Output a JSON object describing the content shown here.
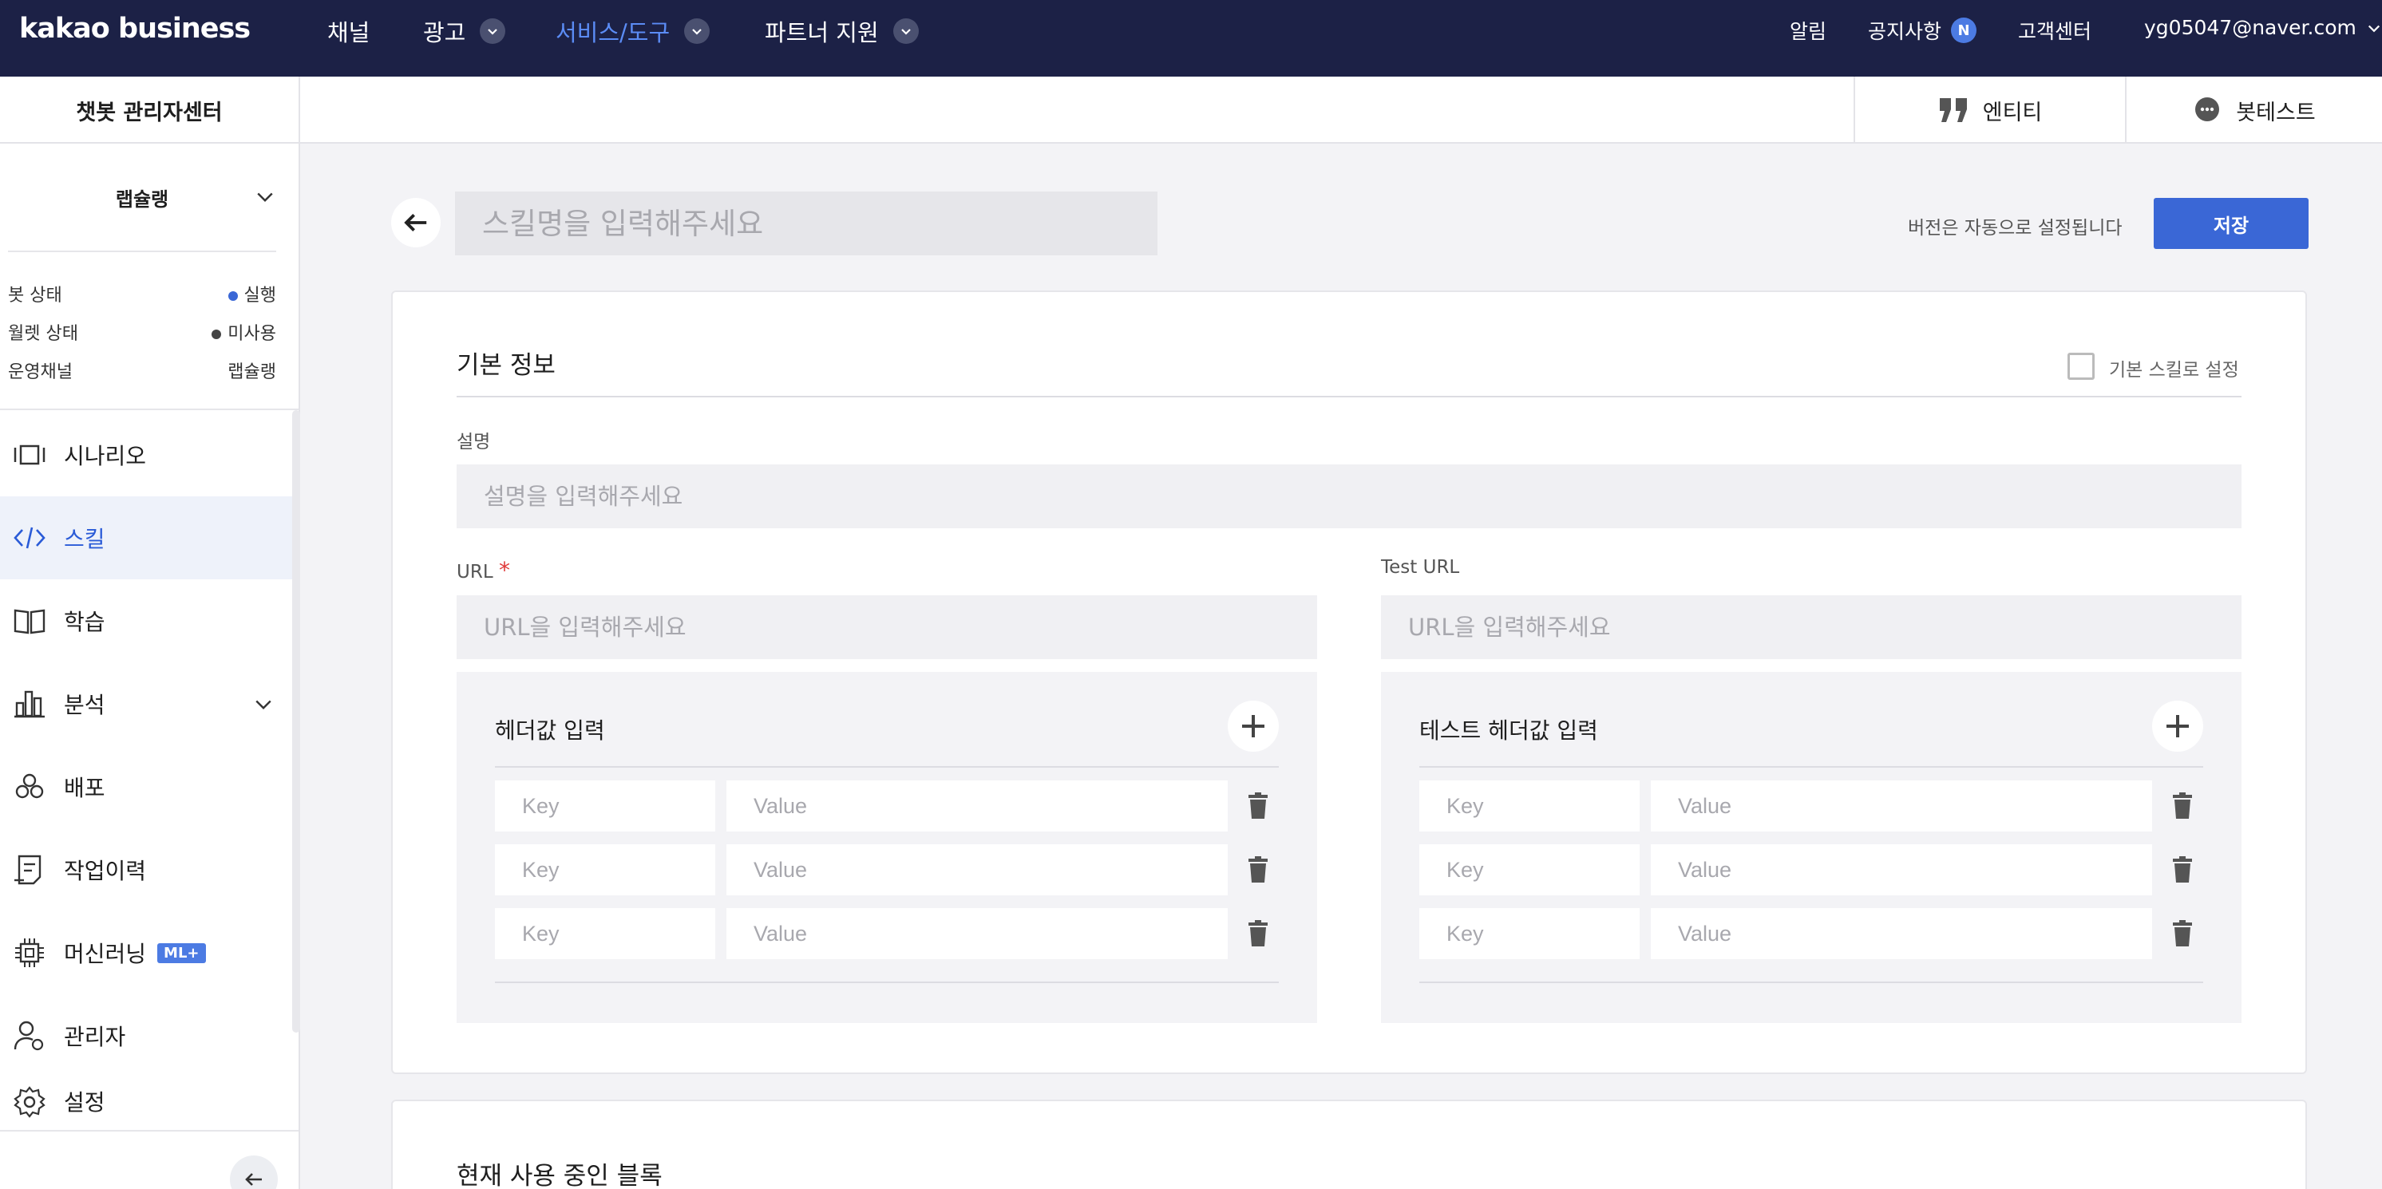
{
  "topnav": {
    "logo": "kakao business",
    "items": [
      {
        "label": "채널"
      },
      {
        "label": "광고"
      },
      {
        "label": "서비스/도구"
      },
      {
        "label": "파트너 지원"
      }
    ],
    "right": {
      "alarm": "알림",
      "notice": "공지사항",
      "notice_badge": "N",
      "support": "고객센터",
      "account": "yg05047@naver.com"
    }
  },
  "subbar": {
    "title": "챗봇 관리자센터",
    "entity": "엔티티",
    "bottest": "봇테스트"
  },
  "sidebar": {
    "bot_name": "랩슐랭",
    "status": [
      {
        "label": "봇 상태",
        "value": "실행",
        "color": "#3a67d6"
      },
      {
        "label": "월렛 상태",
        "value": "미사용",
        "color": "#444444"
      },
      {
        "label": "운영채널",
        "value": "랩슐랭",
        "color": ""
      }
    ],
    "menu": [
      {
        "label": "시나리오",
        "icon": "scenario-icon",
        "active": false
      },
      {
        "label": "스킬",
        "icon": "code-icon",
        "active": true
      },
      {
        "label": "학습",
        "icon": "book-icon",
        "active": false
      },
      {
        "label": "분석",
        "icon": "chart-icon",
        "active": false
      },
      {
        "label": "배포",
        "icon": "deploy-icon",
        "active": false
      },
      {
        "label": "작업이력",
        "icon": "history-icon",
        "active": false
      },
      {
        "label": "머신러닝",
        "icon": "chip-icon",
        "active": false,
        "badge": "ML+"
      },
      {
        "label": "관리자",
        "icon": "admin-icon",
        "active": false
      },
      {
        "label": "설정",
        "icon": "settings-icon",
        "active": false
      }
    ]
  },
  "main": {
    "skill_name_placeholder": "스킬명을 입력해주세요",
    "version_text": "버전은 자동으로 설정됩니다",
    "save_label": "저장",
    "basic_info": {
      "title": "기본 정보",
      "default_skill_label": "기본 스킬로 설정",
      "desc_label": "설명",
      "desc_placeholder": "설명을 입력해주세요",
      "url_label": "URL",
      "url_required": "*",
      "url_placeholder": "URL을 입력해주세요",
      "test_url_label": "Test URL",
      "test_url_placeholder": "URL을 입력해주세요",
      "header_title": "헤더값 입력",
      "test_header_title": "테스트 헤더값 입력",
      "key_placeholder": "Key",
      "value_placeholder": "Value"
    },
    "blocks_title": "현재 사용 중인 블록"
  }
}
